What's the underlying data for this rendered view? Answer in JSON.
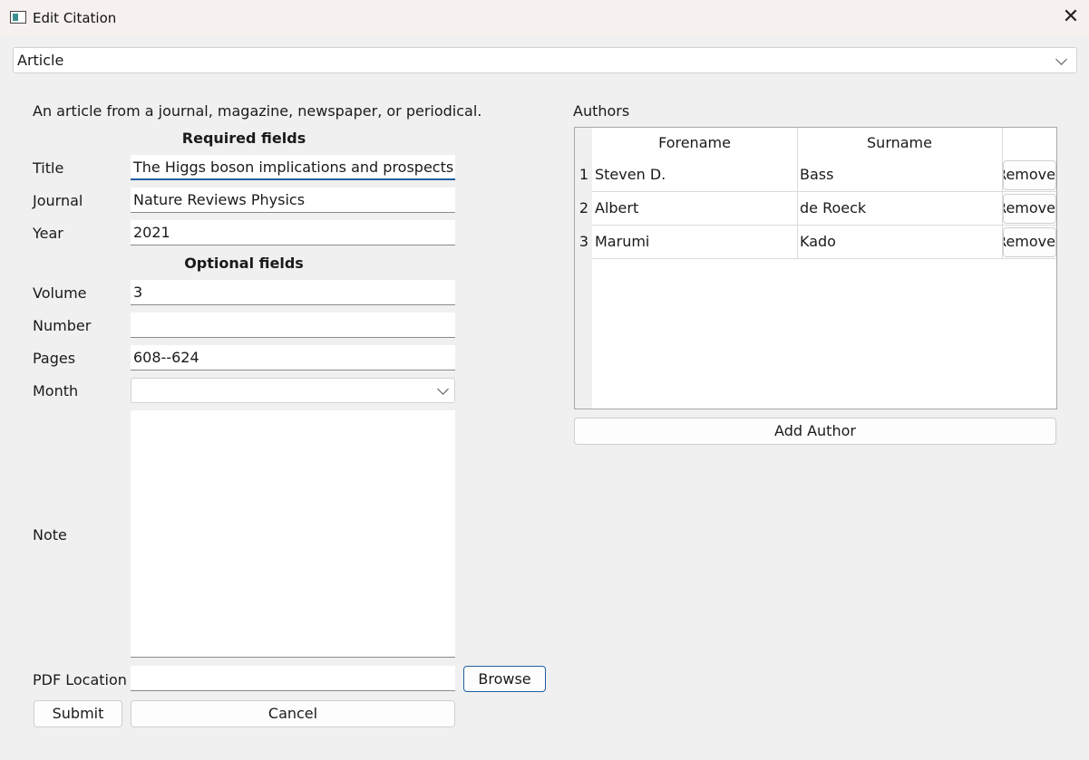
{
  "window": {
    "title": "Edit Citation"
  },
  "type_select": {
    "value": "Article"
  },
  "description": "An article from a journal, magazine, newspaper, or periodical.",
  "required": {
    "heading": "Required fields",
    "title": {
      "label": "Title",
      "value": "The Higgs boson implications and prospects for future discoveries"
    },
    "journal": {
      "label": "Journal",
      "value": "Nature Reviews Physics"
    },
    "year": {
      "label": "Year",
      "value": "2021"
    }
  },
  "optional": {
    "heading": "Optional fields",
    "volume": {
      "label": "Volume",
      "value": "3"
    },
    "number": {
      "label": "Number",
      "value": ""
    },
    "pages": {
      "label": "Pages",
      "value": "608--624"
    },
    "month": {
      "label": "Month",
      "value": ""
    },
    "note": {
      "label": "Note",
      "value": ""
    }
  },
  "pdf": {
    "label": "PDF Location",
    "value": "",
    "browse_label": "Browse"
  },
  "buttons": {
    "submit": "Submit",
    "cancel": "Cancel"
  },
  "authors": {
    "heading": "Authors",
    "columns": [
      "Forename",
      "Surname",
      ""
    ],
    "rows": [
      {
        "num": "1",
        "forename": "Steven D.",
        "surname": "Bass",
        "remove": "Remove"
      },
      {
        "num": "2",
        "forename": "Albert",
        "surname": "de Roeck",
        "remove": "Remove"
      },
      {
        "num": "3",
        "forename": "Marumi",
        "surname": "Kado",
        "remove": "Remove"
      }
    ],
    "add_label": "Add Author"
  }
}
